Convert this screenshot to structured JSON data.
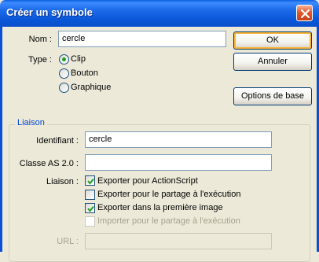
{
  "window": {
    "title": "Créer un symbole",
    "close_icon": "close-icon"
  },
  "name_field": {
    "label": "Nom :",
    "value": "cercle"
  },
  "type_group": {
    "label": "Type :",
    "options": [
      {
        "label": "Clip",
        "selected": true
      },
      {
        "label": "Bouton",
        "selected": false
      },
      {
        "label": "Graphique",
        "selected": false
      }
    ]
  },
  "buttons": {
    "ok": "OK",
    "cancel": "Annuler",
    "basic_options": "Options de base"
  },
  "linkage": {
    "legend": "Liaison",
    "identifier_label": "Identifiant :",
    "identifier_value": "cercle",
    "as_class_label": "Classe AS 2.0 :",
    "as_class_value": "",
    "linkage_label": "Liaison :",
    "checkboxes": [
      {
        "label": "Exporter pour ActionScript",
        "checked": true,
        "enabled": true
      },
      {
        "label": "Exporter pour le partage à l'exécution",
        "checked": false,
        "enabled": true
      },
      {
        "label": "Exporter dans la première image",
        "checked": true,
        "enabled": true
      },
      {
        "label": "Importer pour le partage à l'exécution",
        "checked": false,
        "enabled": false
      }
    ],
    "url_label": "URL :",
    "url_value": ""
  },
  "colors": {
    "title_bar": "#0A5FE0",
    "dialog_bg": "#ECE9D8",
    "focus": "#F8B335",
    "legend": "#0046D5",
    "check": "#21A121"
  }
}
